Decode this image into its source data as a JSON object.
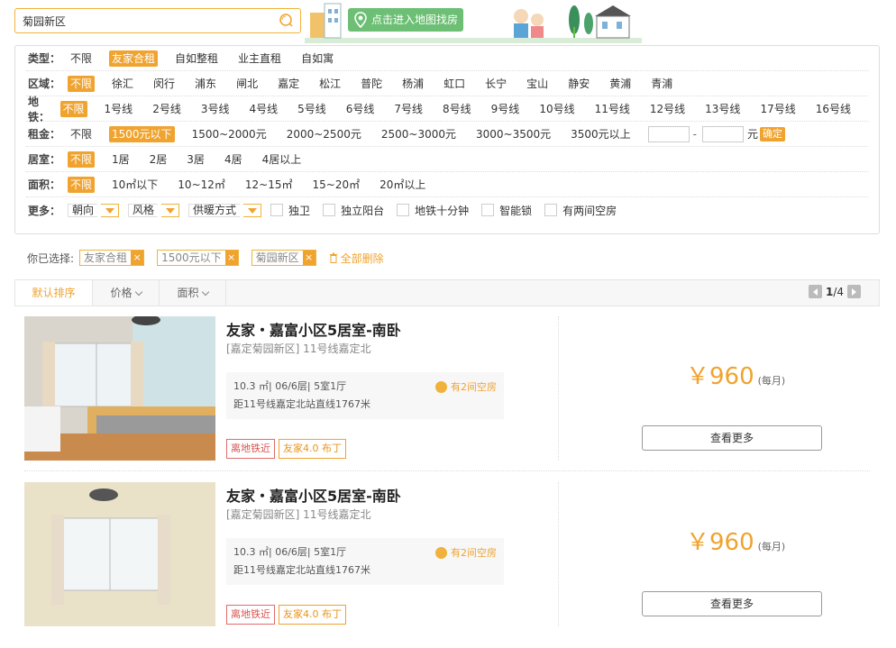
{
  "search": {
    "value": "菊园新区"
  },
  "banner": {
    "map_button": "点击进入地图找房"
  },
  "filters": {
    "type": {
      "label": "类型：",
      "options": [
        "不限",
        "友家合租",
        "自如整租",
        "业主直租",
        "自如寓"
      ],
      "selected": 1
    },
    "district": {
      "label": "区域：",
      "options": [
        "不限",
        "徐汇",
        "闵行",
        "浦东",
        "闸北",
        "嘉定",
        "松江",
        "普陀",
        "杨浦",
        "虹口",
        "长宁",
        "宝山",
        "静安",
        "黄浦",
        "青浦"
      ],
      "selected": 0
    },
    "subway": {
      "label": "地铁：",
      "options": [
        "不限",
        "1号线",
        "2号线",
        "3号线",
        "4号线",
        "5号线",
        "6号线",
        "7号线",
        "8号线",
        "9号线",
        "10号线",
        "11号线",
        "12号线",
        "13号线",
        "17号线",
        "16号线"
      ],
      "selected": 0
    },
    "rent": {
      "label": "租金：",
      "options": [
        "不限",
        "1500元以下",
        "1500~2000元",
        "2000~2500元",
        "2500~3000元",
        "3000~3500元",
        "3500元以上"
      ],
      "selected": 1,
      "separator": "-",
      "unit": "元",
      "confirm": "确定"
    },
    "rooms": {
      "label": "居室：",
      "options": [
        "不限",
        "1居",
        "2居",
        "3居",
        "4居",
        "4居以上"
      ],
      "selected": 0
    },
    "area": {
      "label": "面积：",
      "options": [
        "不限",
        "10㎡以下",
        "10~12㎡",
        "12~15㎡",
        "15~20㎡",
        "20㎡以上"
      ],
      "selected": 0
    },
    "more": {
      "label": "更多：",
      "dropdowns": [
        "朝向",
        "风格",
        "供暖方式"
      ],
      "checks": [
        "独卫",
        "独立阳台",
        "地铁十分钟",
        "智能锁",
        "有两间空房"
      ]
    }
  },
  "chosen": {
    "label": "你已选择:",
    "tags": [
      "友家合租",
      "1500元以下",
      "菊园新区"
    ],
    "close": "×",
    "clear": "全部删除"
  },
  "sort": {
    "default": "默认排序",
    "price": "价格",
    "area": "面积",
    "page_current": "1",
    "page_total": "/4"
  },
  "listings": [
    {
      "title": "友家・嘉富小区5居室-南卧",
      "location": "[嘉定菊园新区] 11号线嘉定北",
      "info": "10.3 ㎡| 06/6层| 5室1厅",
      "distance": "距11号线嘉定北站直线1767米",
      "rooms_free": "有2间空房",
      "tag1": "离地铁近",
      "tag2": "友家4.0 布丁",
      "price": "￥960",
      "unit": "(每月)",
      "more": "查看更多"
    },
    {
      "title": "友家・嘉富小区5居室-南卧",
      "location": "[嘉定菊园新区] 11号线嘉定北",
      "info": "10.3 ㎡| 06/6层| 5室1厅",
      "distance": "距11号线嘉定北站直线1767米",
      "rooms_free": "有2间空房",
      "tag1": "离地铁近",
      "tag2": "友家4.0 布丁",
      "price": "￥960",
      "unit": "(每月)",
      "more": "查看更多"
    }
  ],
  "colors": {
    "accent": "#f0a32f",
    "green": "#6cbf74"
  }
}
